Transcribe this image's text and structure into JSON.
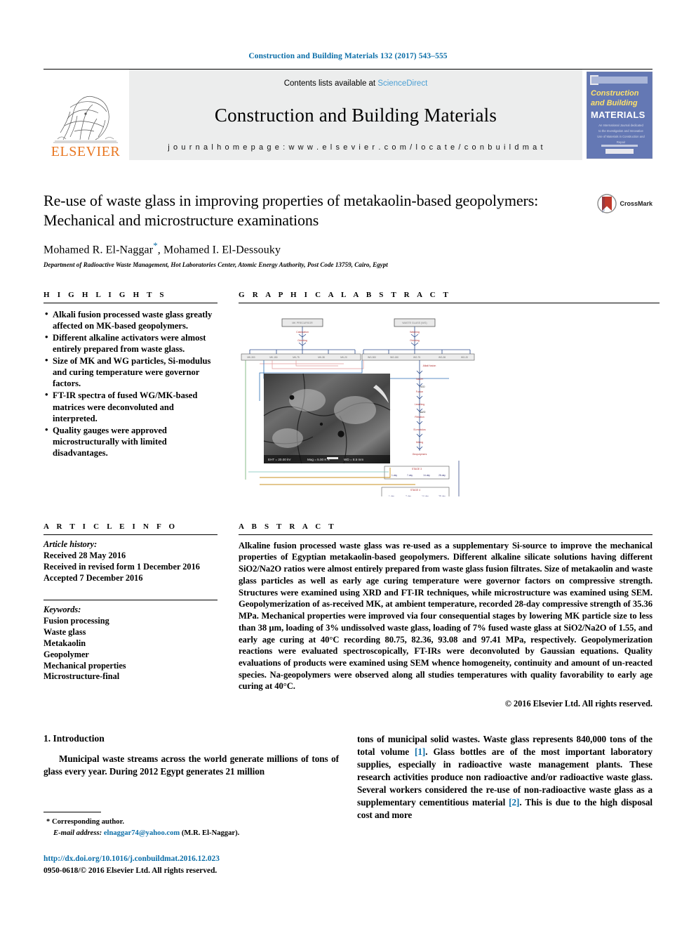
{
  "running_head": "Construction and Building Materials 132 (2017) 543–555",
  "masthead": {
    "publisher": "ELSEVIER",
    "contents_prefix": "Contents lists available at ",
    "contents_link": "ScienceDirect",
    "journal_name": "Construction and Building Materials",
    "homepage": "j o u r n a l   h o m e p a g e :   w w w . e l s e v i e r . c o m / l o c a t e / c o n b u i l d m a t",
    "cover": {
      "line1": "Construction",
      "line2": "and Building",
      "line3": "MATERIALS",
      "blurb": "An International Journal dedicated to the Investigation and Innovative Use of Materials in Construction and Repair"
    }
  },
  "article": {
    "title": "Re-use of waste glass in improving properties of metakaolin-based geopolymers: Mechanical and microstructure examinations",
    "authors_part1": "Mohamed R. El-Naggar",
    "authors_star": "*",
    "authors_part2": ", Mohamed I. El-Dessouky",
    "affiliation": "Department of Radioactive Waste Management, Hot Laboratories Center, Atomic Energy Authority, Post Code 13759, Cairo, Egypt",
    "crossmark_label": "CrossMark"
  },
  "highlights": {
    "heading": "H I G H L I G H T S",
    "items": [
      "Alkali fusion processed waste glass greatly affected on MK-based geopolymers.",
      "Different alkaline activators were almost entirely prepared from waste glass.",
      "Size of MK and WG particles, Si-modulus and curing temperature were governor factors.",
      "FT-IR spectra of fused WG/MK-based matrices were deconvoluted and interpreted.",
      "Quality gauges were approved microstructurally with limited disadvantages."
    ]
  },
  "graphical_abstract": {
    "heading": "G R A P H I C A L   A B S T R A C T",
    "description": "Process flow diagram of metakaolin and waste glass treatment routes with an SEM micrograph of the geopolymer matrix inset"
  },
  "article_info": {
    "heading": "A R T I C L E   I N F O",
    "history_label": "Article history:",
    "received": "Received 28 May 2016",
    "revised": "Received in revised form 1 December 2016",
    "accepted": "Accepted 7 December 2016",
    "keywords_label": "Keywords:",
    "keywords": [
      "Fusion processing",
      "Waste glass",
      "Metakaolin",
      "Geopolymer",
      "Mechanical properties",
      "Microstructure-final"
    ]
  },
  "abstract": {
    "heading": "A B S T R A C T",
    "text": "Alkaline fusion processed waste glass was re-used as a supplementary Si-source to improve the mechanical properties of Egyptian metakaolin-based geopolymers. Different alkaline silicate solutions having different SiO2/Na2O ratios were almost entirely prepared from waste glass fusion filtrates. Size of metakaolin and waste glass particles as well as early age curing temperature were governor factors on compressive strength. Structures were examined using XRD and FT-IR techniques, while microstructure was examined using SEM. Geopolymerization of as-received MK, at ambient temperature, recorded 28-day compressive strength of 35.36 MPa. Mechanical properties were improved via four consequential stages by lowering MK particle size to less than 38 µm, loading of 3% undissolved waste glass, loading of 7% fused waste glass at SiO2/Na2O of 1.55, and early age curing at 40°C recording 80.75, 82.36, 93.08 and 97.41 MPa, respectively. Geopolymerization reactions were evaluated spectroscopically, FT-IRs were deconvoluted by Gaussian equations. Quality evaluations of products were examined using SEM whence homogeneity, continuity and amount of un-reacted species. Na-geopolymers were observed along all studies temperatures with quality favorability to early age curing at 40°C.",
    "copyright": "© 2016 Elsevier Ltd. All rights reserved."
  },
  "introduction": {
    "heading": "1. Introduction",
    "col1_para": "Municipal waste streams across the world generate millions of tons of glass every year. During 2012 Egypt generates 21 million",
    "col2_para_a": "tons of municipal solid wastes. Waste glass represents 840,000 tons of the total volume ",
    "col2_ref1": "[1]",
    "col2_para_b": ". Glass bottles are of the most important laboratory supplies, especially in radioactive waste management plants. These research activities produce non radioactive and/or radioactive waste glass. Several workers considered the re-use of non-radioactive waste glass as a supplementary cementitious material ",
    "col2_ref2": "[2]",
    "col2_para_c": ". This is due to the high disposal cost and more"
  },
  "footnote": {
    "star": "*",
    "corresponding": "Corresponding author.",
    "email_label": "E-mail address:",
    "email": "elnaggar74@yahoo.com",
    "email_suffix": "(M.R. El-Naggar)."
  },
  "footer": {
    "doi": "http://dx.doi.org/10.1016/j.conbuildmat.2016.12.023",
    "issn_line": "0950-0618/© 2016 Elsevier Ltd. All rights reserved."
  },
  "colors": {
    "link": "#0b6ea8",
    "sciencedirect": "#4a9fd4",
    "elsevier_orange": "#e87722",
    "band_gray": "#eceded",
    "cover_blue": "#6478b4"
  }
}
